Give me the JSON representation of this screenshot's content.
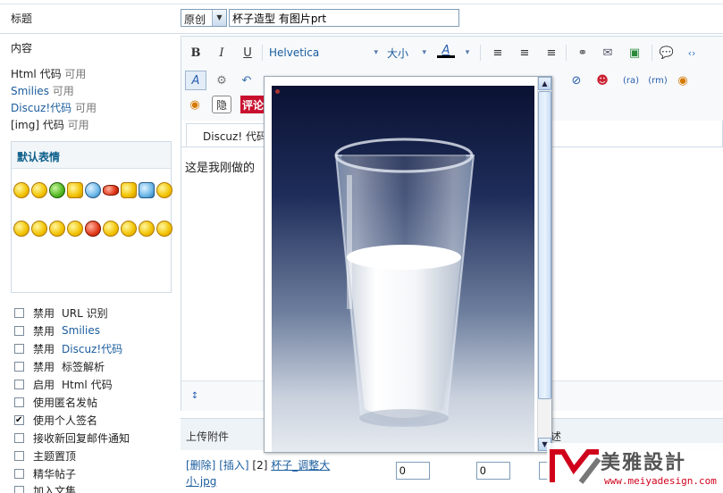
{
  "form": {
    "title_label": "标题",
    "title_type": "原创",
    "title_value": "杯子造型 有图片prt",
    "content_label": "内容"
  },
  "left_info": {
    "html_label": "Html 代码",
    "html_status": "可用",
    "smilies_label": "Smilies",
    "smilies_status": "可用",
    "discuz_label": "Discuz!代码",
    "discuz_status": "可用",
    "img_label": "[img] 代码",
    "img_status": "可用"
  },
  "smilies": {
    "title": "默认表情"
  },
  "options": [
    {
      "prefix": "禁用",
      "text": "URL 识别",
      "link": false,
      "checked": false
    },
    {
      "prefix": "禁用",
      "text": "Smilies",
      "link": true,
      "checked": false
    },
    {
      "prefix": "禁用",
      "text": "Discuz!代码",
      "link": true,
      "checked": false
    },
    {
      "prefix": "禁用",
      "text": "标签解析",
      "link": false,
      "checked": false
    },
    {
      "prefix": "启用",
      "text": "Html 代码",
      "link": false,
      "checked": false
    },
    {
      "prefix": "",
      "text": "使用匿名发帖",
      "link": false,
      "checked": false
    },
    {
      "prefix": "",
      "text": "使用个人签名",
      "link": false,
      "checked": true
    },
    {
      "prefix": "",
      "text": "接收新回复邮件通知",
      "link": false,
      "checked": false
    },
    {
      "prefix": "",
      "text": "主题置顶",
      "link": false,
      "checked": false
    },
    {
      "prefix": "",
      "text": "精华帖子",
      "link": false,
      "checked": false
    },
    {
      "prefix": "",
      "text": "加入文集",
      "link": false,
      "checked": false
    }
  ],
  "toolbar": {
    "bold": "B",
    "italic": "I",
    "underline": "U",
    "font_name": "Helvetica",
    "font_size": "大小",
    "font_color": "A",
    "hide_label": "隐",
    "review_label": "评论"
  },
  "editor": {
    "tab_label": "Discuz! 代码",
    "body_text": "这是我刚做的"
  },
  "attachments": {
    "header": "上传附件",
    "header_right": "述",
    "delete": "[删除]",
    "insert": "[插入]",
    "index": "[2]",
    "filename_line1": "杯子_调整大",
    "filename_line2": "小.jpg",
    "field1": "0",
    "field2": "0"
  },
  "watermark": {
    "brand": "美雅設計",
    "url": "www.meiyadesign.com"
  },
  "colors": {
    "link": "#1a5c9e",
    "review_bg": "#c8102e",
    "watermark_red": "#d0021b"
  }
}
